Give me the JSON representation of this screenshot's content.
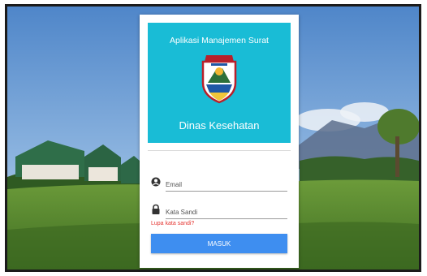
{
  "app": {
    "title": "Aplikasi Manajemen Surat",
    "organization": "Dinas Kesehatan"
  },
  "form": {
    "email_placeholder": "Email",
    "password_placeholder": "Kata Sandi",
    "forgot_label": "Lupa kata sandi?",
    "submit_label": "MASUK"
  },
  "colors": {
    "header": "#19bcd6",
    "button": "#3e8ef0",
    "link": "#e53935"
  },
  "icons": {
    "email_field": "user-circle-icon",
    "password_field": "lock-icon",
    "emblem": "regional-emblem"
  }
}
